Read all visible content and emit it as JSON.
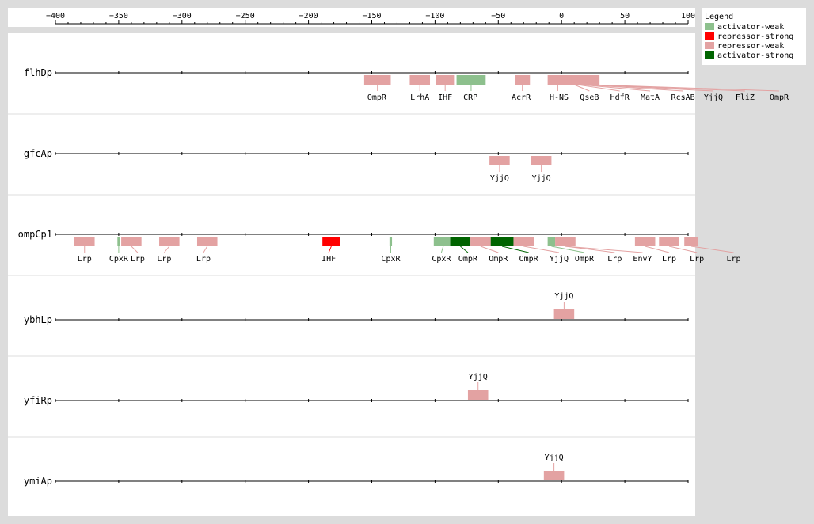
{
  "axis": {
    "ticks": [
      -400,
      -350,
      -300,
      -250,
      -200,
      -150,
      -100,
      -50,
      0,
      50,
      100
    ],
    "range": [
      -400,
      100
    ]
  },
  "legend": {
    "title": "Legend",
    "items": [
      {
        "key": "activator-weak",
        "label": "activator-weak",
        "color": "#8dc08d"
      },
      {
        "key": "repressor-strong",
        "label": "repressor-strong",
        "color": "#ff0000"
      },
      {
        "key": "repressor-weak",
        "label": "repressor-weak",
        "color": "#e3a2a2"
      },
      {
        "key": "activator-strong",
        "label": "activator-strong",
        "color": "#006400"
      }
    ]
  },
  "promoters": [
    {
      "name": "flhDp",
      "label_side": "below",
      "sites": [
        {
          "tf": "OmpR",
          "start": -156,
          "end": -135,
          "type": "repressor-weak",
          "label_at": -146
        },
        {
          "tf": "LrhA",
          "start": -120,
          "end": -104,
          "type": "repressor-weak",
          "label_at": -112
        },
        {
          "tf": "IHF",
          "start": -99,
          "end": -85,
          "type": "repressor-weak",
          "label_at": -92
        },
        {
          "tf": "CRP",
          "start": -83,
          "end": -60,
          "type": "activator-weak",
          "label_at": -72
        },
        {
          "tf": "AcrR",
          "start": -37,
          "end": -25,
          "type": "repressor-weak",
          "label_at": -32
        },
        {
          "tf": "H-NS",
          "start": -11,
          "end": 5,
          "type": "repressor-weak",
          "label_at": -2
        },
        {
          "tf": "QseB",
          "start": 0,
          "end": 20,
          "type": "repressor-weak",
          "label_at": 22
        },
        {
          "tf": "HdfR",
          "start": 5,
          "end": 20,
          "type": "repressor-weak",
          "label_at": 46
        },
        {
          "tf": "MatA",
          "start": 8,
          "end": 22,
          "type": "repressor-weak",
          "label_at": 70
        },
        {
          "tf": "RcsAB",
          "start": 10,
          "end": 25,
          "type": "repressor-weak",
          "label_at": 96
        },
        {
          "tf": "YjjQ",
          "start": 12,
          "end": 28,
          "type": "repressor-weak",
          "label_at": 120
        },
        {
          "tf": "FliZ",
          "start": 14,
          "end": 28,
          "type": "repressor-weak",
          "label_at": 145
        },
        {
          "tf": "OmpR",
          "start": 16,
          "end": 30,
          "type": "repressor-weak",
          "label_at": 172
        }
      ]
    },
    {
      "name": "gfcAp",
      "label_side": "below",
      "sites": [
        {
          "tf": "YjjQ",
          "start": -57,
          "end": -41,
          "type": "repressor-weak",
          "label_at": -49
        },
        {
          "tf": "YjjQ",
          "start": -24,
          "end": -8,
          "type": "repressor-weak",
          "label_at": -16
        }
      ]
    },
    {
      "name": "ompCp1",
      "label_side": "below",
      "sites": [
        {
          "tf": "Lrp",
          "start": -385,
          "end": -369,
          "type": "repressor-weak",
          "label_at": -377
        },
        {
          "tf": "CpxR",
          "start": -351,
          "end": -349,
          "type": "activator-weak",
          "label_at": -350
        },
        {
          "tf": "Lrp",
          "start": -348,
          "end": -332,
          "type": "repressor-weak",
          "label_at": -335
        },
        {
          "tf": "Lrp",
          "start": -318,
          "end": -302,
          "type": "repressor-weak",
          "label_at": -314
        },
        {
          "tf": "Lrp",
          "start": -288,
          "end": -272,
          "type": "repressor-weak",
          "label_at": -283
        },
        {
          "tf": "IHF",
          "start": -189,
          "end": -175,
          "type": "repressor-strong",
          "label_at": -184
        },
        {
          "tf": "CpxR",
          "start": -136,
          "end": -134,
          "type": "activator-weak",
          "label_at": -135
        },
        {
          "tf": "CpxR",
          "start": -101,
          "end": -86,
          "type": "activator-weak",
          "label_at": -95
        },
        {
          "tf": "OmpR",
          "start": -88,
          "end": -72,
          "type": "activator-strong",
          "label_at": -74
        },
        {
          "tf": "OmpR",
          "start": -72,
          "end": -56,
          "type": "repressor-weak",
          "label_at": -50
        },
        {
          "tf": "OmpR",
          "start": -56,
          "end": -38,
          "type": "activator-strong",
          "label_at": -26
        },
        {
          "tf": "YjjQ",
          "start": -38,
          "end": -22,
          "type": "repressor-weak",
          "label_at": -2
        },
        {
          "tf": "OmpR",
          "start": -11,
          "end": -5,
          "type": "activator-weak",
          "label_at": 18
        },
        {
          "tf": "Lrp",
          "start": -5,
          "end": 11,
          "type": "repressor-weak",
          "label_at": 42
        },
        {
          "tf": "EnvY",
          "start": -5,
          "end": 10,
          "type": "repressor-weak",
          "label_at": 64
        },
        {
          "tf": "Lrp",
          "start": 58,
          "end": 74,
          "type": "repressor-weak",
          "label_at": 85
        },
        {
          "tf": "Lrp",
          "start": 77,
          "end": 93,
          "type": "repressor-weak",
          "label_at": 107
        },
        {
          "tf": "Lrp",
          "start": 97,
          "end": 108,
          "type": "repressor-weak",
          "label_at": 136
        }
      ]
    },
    {
      "name": "ybhLp",
      "label_side": "above",
      "sites": [
        {
          "tf": "YjjQ",
          "start": -6,
          "end": 10,
          "type": "repressor-weak",
          "label_at": 2
        }
      ]
    },
    {
      "name": "yfiRp",
      "label_side": "above",
      "sites": [
        {
          "tf": "YjjQ",
          "start": -74,
          "end": -58,
          "type": "repressor-weak",
          "label_at": -66
        }
      ]
    },
    {
      "name": "ymiAp",
      "label_side": "above",
      "sites": [
        {
          "tf": "YjjQ",
          "start": -14,
          "end": 2,
          "type": "repressor-weak",
          "label_at": -6
        }
      ]
    }
  ]
}
